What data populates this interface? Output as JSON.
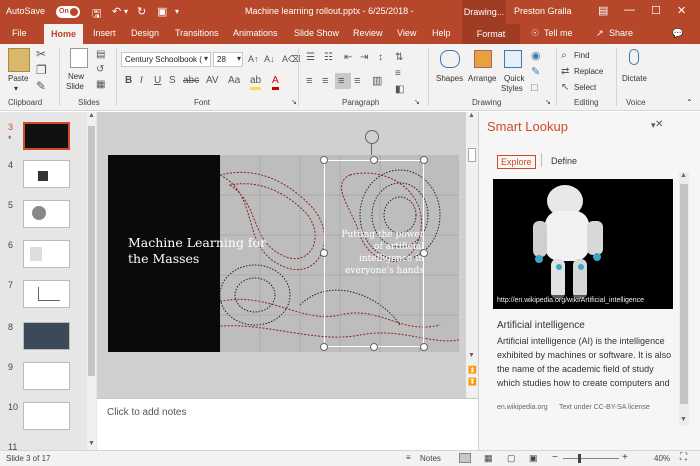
{
  "title_bar": {
    "autosave_label": "AutoSave",
    "autosave_state": "On",
    "document_title": "Machine learning rollout.pptx  -  6/25/2018  -",
    "context_tab": "Drawing...",
    "user_name": "Preston Gralla"
  },
  "tabs": [
    "File",
    "Home",
    "Insert",
    "Design",
    "Transitions",
    "Animations",
    "Slide Show",
    "Review",
    "View",
    "Help"
  ],
  "format_tab": "Format",
  "tell_me": "Tell me",
  "share": "Share",
  "ribbon": {
    "clipboard": {
      "label": "Clipboard",
      "paste": "Paste"
    },
    "slides": {
      "label": "Slides",
      "new_slide_1": "New",
      "new_slide_2": "Slide"
    },
    "font": {
      "label": "Font",
      "font_name": "Century Schoolbook (",
      "font_size": "28"
    },
    "paragraph": {
      "label": "Paragraph"
    },
    "drawing": {
      "label": "Drawing",
      "shapes": "Shapes",
      "arrange": "Arrange",
      "quick_styles_1": "Quick",
      "quick_styles_2": "Styles"
    },
    "editing": {
      "label": "Editing",
      "find": "Find",
      "replace": "Replace",
      "select": "Select"
    },
    "voice": {
      "label": "Voice",
      "dictate": "Dictate"
    }
  },
  "thumbnails": {
    "numbers": [
      "3",
      "4",
      "5",
      "6",
      "7",
      "8",
      "9",
      "10",
      "11"
    ],
    "star": "*"
  },
  "slide": {
    "title_1": "Machine Learning for",
    "title_2": "the Masses",
    "sub_1": "Putting the power",
    "sub_2": "of artificial",
    "sub_3": "intelligence in",
    "sub_4": "everyone's hands"
  },
  "notes_placeholder": "Click to add notes",
  "smart_lookup": {
    "title": "Smart Lookup",
    "tab_explore": "Explore",
    "tab_define": "Define",
    "image_url": "http://en.wikipedia.org/wiki/Artificial_intelligence",
    "result_title": "Artificial intelligence",
    "result_text": "Artificial intelligence (AI) is the intelligence exhibited by machines or software. It is also the name of the academic field of study which studies how to create computers and compu...",
    "source": "en.wikipedia.org",
    "license": "Text under CC-BY-SA license"
  },
  "status": {
    "slide_of": "Slide 3 of 17",
    "notes": "Notes",
    "zoom": "40%"
  },
  "colors": {
    "accent": "#b7472a",
    "selected_thumb": "#d04a26"
  }
}
